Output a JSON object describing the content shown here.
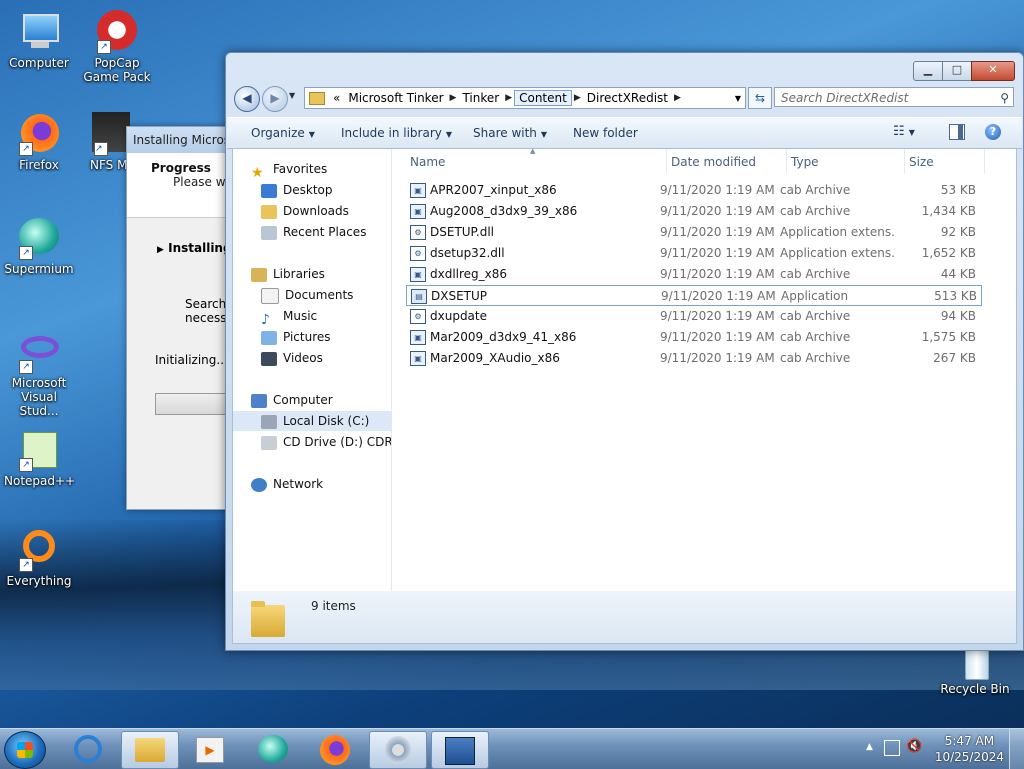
{
  "desktop": {
    "icons": [
      {
        "label": "Computer"
      },
      {
        "label": "PopCap Game Pack"
      },
      {
        "label": "Firefox"
      },
      {
        "label": "NFS Most Wanted"
      },
      {
        "label": "Supermium"
      },
      {
        "label": "Microsoft Visual Stud..."
      },
      {
        "label": "Notepad++"
      },
      {
        "label": "Everything"
      },
      {
        "label": "Recycle Bin"
      }
    ]
  },
  "installer": {
    "title": "Installing Microso",
    "progress": "Progress",
    "wait": "Please wai",
    "installing": "Installing",
    "searching": "Searchin",
    "necessary": "necessa",
    "initializing": "Initializing..."
  },
  "explorer": {
    "breadcrumbs": [
      "Microsoft Tinker",
      "Tinker",
      "Content",
      "DirectXRedist"
    ],
    "overflow": "«",
    "search_placeholder": "Search DirectXRedist",
    "toolbar": {
      "organize": "Organize",
      "include": "Include in library",
      "share": "Share with",
      "new_folder": "New folder"
    },
    "nav": {
      "favorites": "Favorites",
      "desktop": "Desktop",
      "downloads": "Downloads",
      "recent": "Recent Places",
      "libraries": "Libraries",
      "documents": "Documents",
      "music": "Music",
      "pictures": "Pictures",
      "videos": "Videos",
      "computer": "Computer",
      "local_disk": "Local Disk (C:)",
      "cd_drive": "CD Drive (D:) CDROM",
      "network": "Network"
    },
    "columns": {
      "name": "Name",
      "date": "Date modified",
      "type": "Type",
      "size": "Size"
    },
    "files": [
      {
        "name": "APR2007_xinput_x86",
        "date": "9/11/2020 1:19 AM",
        "type": "cab Archive",
        "size": "53 KB"
      },
      {
        "name": "Aug2008_d3dx9_39_x86",
        "date": "9/11/2020 1:19 AM",
        "type": "cab Archive",
        "size": "1,434 KB"
      },
      {
        "name": "DSETUP.dll",
        "date": "9/11/2020 1:19 AM",
        "type": "Application extens...",
        "size": "92 KB"
      },
      {
        "name": "dsetup32.dll",
        "date": "9/11/2020 1:19 AM",
        "type": "Application extens...",
        "size": "1,652 KB"
      },
      {
        "name": "dxdllreg_x86",
        "date": "9/11/2020 1:19 AM",
        "type": "cab Archive",
        "size": "44 KB"
      },
      {
        "name": "DXSETUP",
        "date": "9/11/2020 1:19 AM",
        "type": "Application",
        "size": "513 KB"
      },
      {
        "name": "dxupdate",
        "date": "9/11/2020 1:19 AM",
        "type": "cab Archive",
        "size": "94 KB"
      },
      {
        "name": "Mar2009_d3dx9_41_x86",
        "date": "9/11/2020 1:19 AM",
        "type": "cab Archive",
        "size": "1,575 KB"
      },
      {
        "name": "Mar2009_XAudio_x86",
        "date": "9/11/2020 1:19 AM",
        "type": "cab Archive",
        "size": "267 KB"
      }
    ],
    "item_count": "9 items"
  },
  "taskbar": {
    "time": "5:47 AM",
    "date": "10/25/2024"
  }
}
